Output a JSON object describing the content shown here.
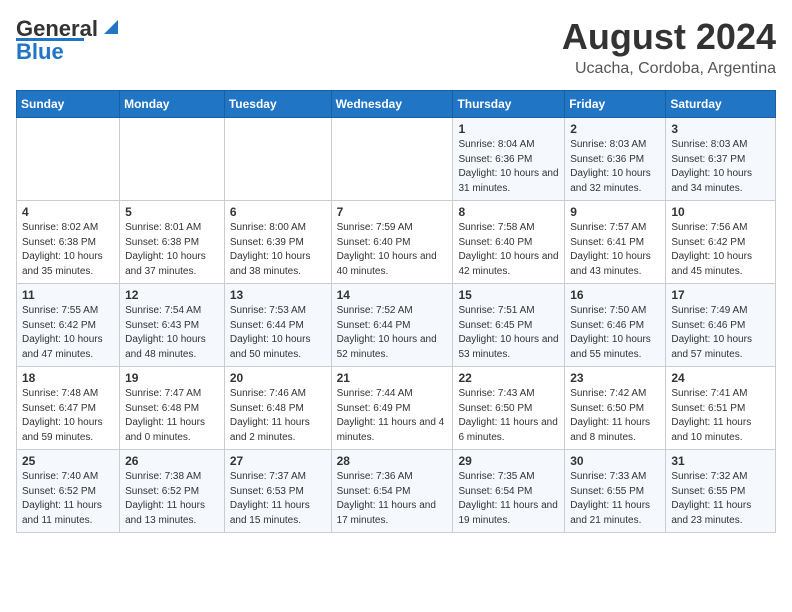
{
  "header": {
    "logo_line1": "General",
    "logo_line2": "Blue",
    "main_title": "August 2024",
    "subtitle": "Ucacha, Cordoba, Argentina"
  },
  "days_of_week": [
    "Sunday",
    "Monday",
    "Tuesday",
    "Wednesday",
    "Thursday",
    "Friday",
    "Saturday"
  ],
  "weeks": [
    [
      {
        "day": "",
        "info": ""
      },
      {
        "day": "",
        "info": ""
      },
      {
        "day": "",
        "info": ""
      },
      {
        "day": "",
        "info": ""
      },
      {
        "day": "1",
        "info": "Sunrise: 8:04 AM\nSunset: 6:36 PM\nDaylight: 10 hours\nand 31 minutes."
      },
      {
        "day": "2",
        "info": "Sunrise: 8:03 AM\nSunset: 6:36 PM\nDaylight: 10 hours\nand 32 minutes."
      },
      {
        "day": "3",
        "info": "Sunrise: 8:03 AM\nSunset: 6:37 PM\nDaylight: 10 hours\nand 34 minutes."
      }
    ],
    [
      {
        "day": "4",
        "info": "Sunrise: 8:02 AM\nSunset: 6:38 PM\nDaylight: 10 hours\nand 35 minutes."
      },
      {
        "day": "5",
        "info": "Sunrise: 8:01 AM\nSunset: 6:38 PM\nDaylight: 10 hours\nand 37 minutes."
      },
      {
        "day": "6",
        "info": "Sunrise: 8:00 AM\nSunset: 6:39 PM\nDaylight: 10 hours\nand 38 minutes."
      },
      {
        "day": "7",
        "info": "Sunrise: 7:59 AM\nSunset: 6:40 PM\nDaylight: 10 hours\nand 40 minutes."
      },
      {
        "day": "8",
        "info": "Sunrise: 7:58 AM\nSunset: 6:40 PM\nDaylight: 10 hours\nand 42 minutes."
      },
      {
        "day": "9",
        "info": "Sunrise: 7:57 AM\nSunset: 6:41 PM\nDaylight: 10 hours\nand 43 minutes."
      },
      {
        "day": "10",
        "info": "Sunrise: 7:56 AM\nSunset: 6:42 PM\nDaylight: 10 hours\nand 45 minutes."
      }
    ],
    [
      {
        "day": "11",
        "info": "Sunrise: 7:55 AM\nSunset: 6:42 PM\nDaylight: 10 hours\nand 47 minutes."
      },
      {
        "day": "12",
        "info": "Sunrise: 7:54 AM\nSunset: 6:43 PM\nDaylight: 10 hours\nand 48 minutes."
      },
      {
        "day": "13",
        "info": "Sunrise: 7:53 AM\nSunset: 6:44 PM\nDaylight: 10 hours\nand 50 minutes."
      },
      {
        "day": "14",
        "info": "Sunrise: 7:52 AM\nSunset: 6:44 PM\nDaylight: 10 hours\nand 52 minutes."
      },
      {
        "day": "15",
        "info": "Sunrise: 7:51 AM\nSunset: 6:45 PM\nDaylight: 10 hours\nand 53 minutes."
      },
      {
        "day": "16",
        "info": "Sunrise: 7:50 AM\nSunset: 6:46 PM\nDaylight: 10 hours\nand 55 minutes."
      },
      {
        "day": "17",
        "info": "Sunrise: 7:49 AM\nSunset: 6:46 PM\nDaylight: 10 hours\nand 57 minutes."
      }
    ],
    [
      {
        "day": "18",
        "info": "Sunrise: 7:48 AM\nSunset: 6:47 PM\nDaylight: 10 hours\nand 59 minutes."
      },
      {
        "day": "19",
        "info": "Sunrise: 7:47 AM\nSunset: 6:48 PM\nDaylight: 11 hours\nand 0 minutes."
      },
      {
        "day": "20",
        "info": "Sunrise: 7:46 AM\nSunset: 6:48 PM\nDaylight: 11 hours\nand 2 minutes."
      },
      {
        "day": "21",
        "info": "Sunrise: 7:44 AM\nSunset: 6:49 PM\nDaylight: 11 hours\nand 4 minutes."
      },
      {
        "day": "22",
        "info": "Sunrise: 7:43 AM\nSunset: 6:50 PM\nDaylight: 11 hours\nand 6 minutes."
      },
      {
        "day": "23",
        "info": "Sunrise: 7:42 AM\nSunset: 6:50 PM\nDaylight: 11 hours\nand 8 minutes."
      },
      {
        "day": "24",
        "info": "Sunrise: 7:41 AM\nSunset: 6:51 PM\nDaylight: 11 hours\nand 10 minutes."
      }
    ],
    [
      {
        "day": "25",
        "info": "Sunrise: 7:40 AM\nSunset: 6:52 PM\nDaylight: 11 hours\nand 11 minutes."
      },
      {
        "day": "26",
        "info": "Sunrise: 7:38 AM\nSunset: 6:52 PM\nDaylight: 11 hours\nand 13 minutes."
      },
      {
        "day": "27",
        "info": "Sunrise: 7:37 AM\nSunset: 6:53 PM\nDaylight: 11 hours\nand 15 minutes."
      },
      {
        "day": "28",
        "info": "Sunrise: 7:36 AM\nSunset: 6:54 PM\nDaylight: 11 hours\nand 17 minutes."
      },
      {
        "day": "29",
        "info": "Sunrise: 7:35 AM\nSunset: 6:54 PM\nDaylight: 11 hours\nand 19 minutes."
      },
      {
        "day": "30",
        "info": "Sunrise: 7:33 AM\nSunset: 6:55 PM\nDaylight: 11 hours\nand 21 minutes."
      },
      {
        "day": "31",
        "info": "Sunrise: 7:32 AM\nSunset: 6:55 PM\nDaylight: 11 hours\nand 23 minutes."
      }
    ]
  ]
}
